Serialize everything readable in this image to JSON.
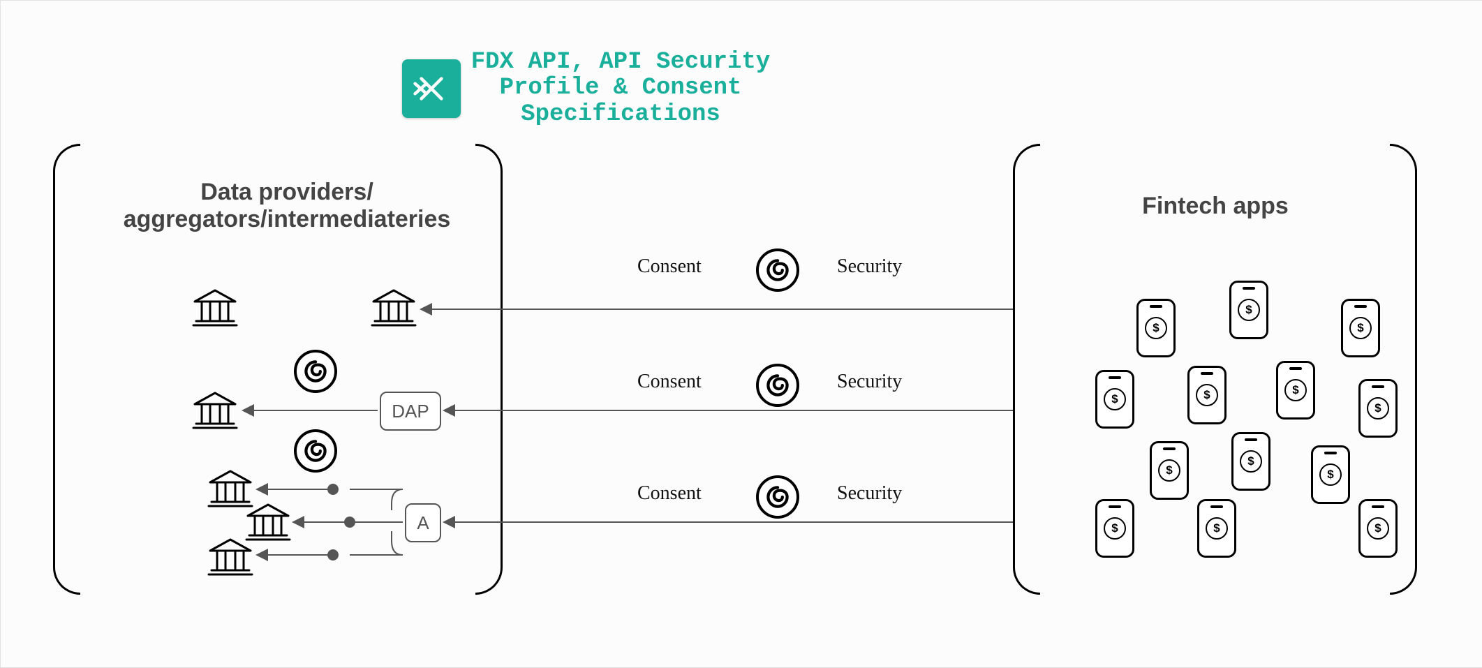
{
  "title_lines": [
    "FDX API, API Security",
    "Profile & Consent",
    "Specifications"
  ],
  "left_group_title": "Data providers/\naggregators/intermediateries",
  "right_group_title": "Fintech apps",
  "flows": [
    {
      "consent": "Consent",
      "security": "Security"
    },
    {
      "consent": "Consent",
      "security": "Security"
    },
    {
      "consent": "Consent",
      "security": "Security"
    }
  ],
  "dap_label": "DAP",
  "agg_label": "A",
  "phone_glyph": "$",
  "colors": {
    "accent": "#1aaf9b"
  }
}
